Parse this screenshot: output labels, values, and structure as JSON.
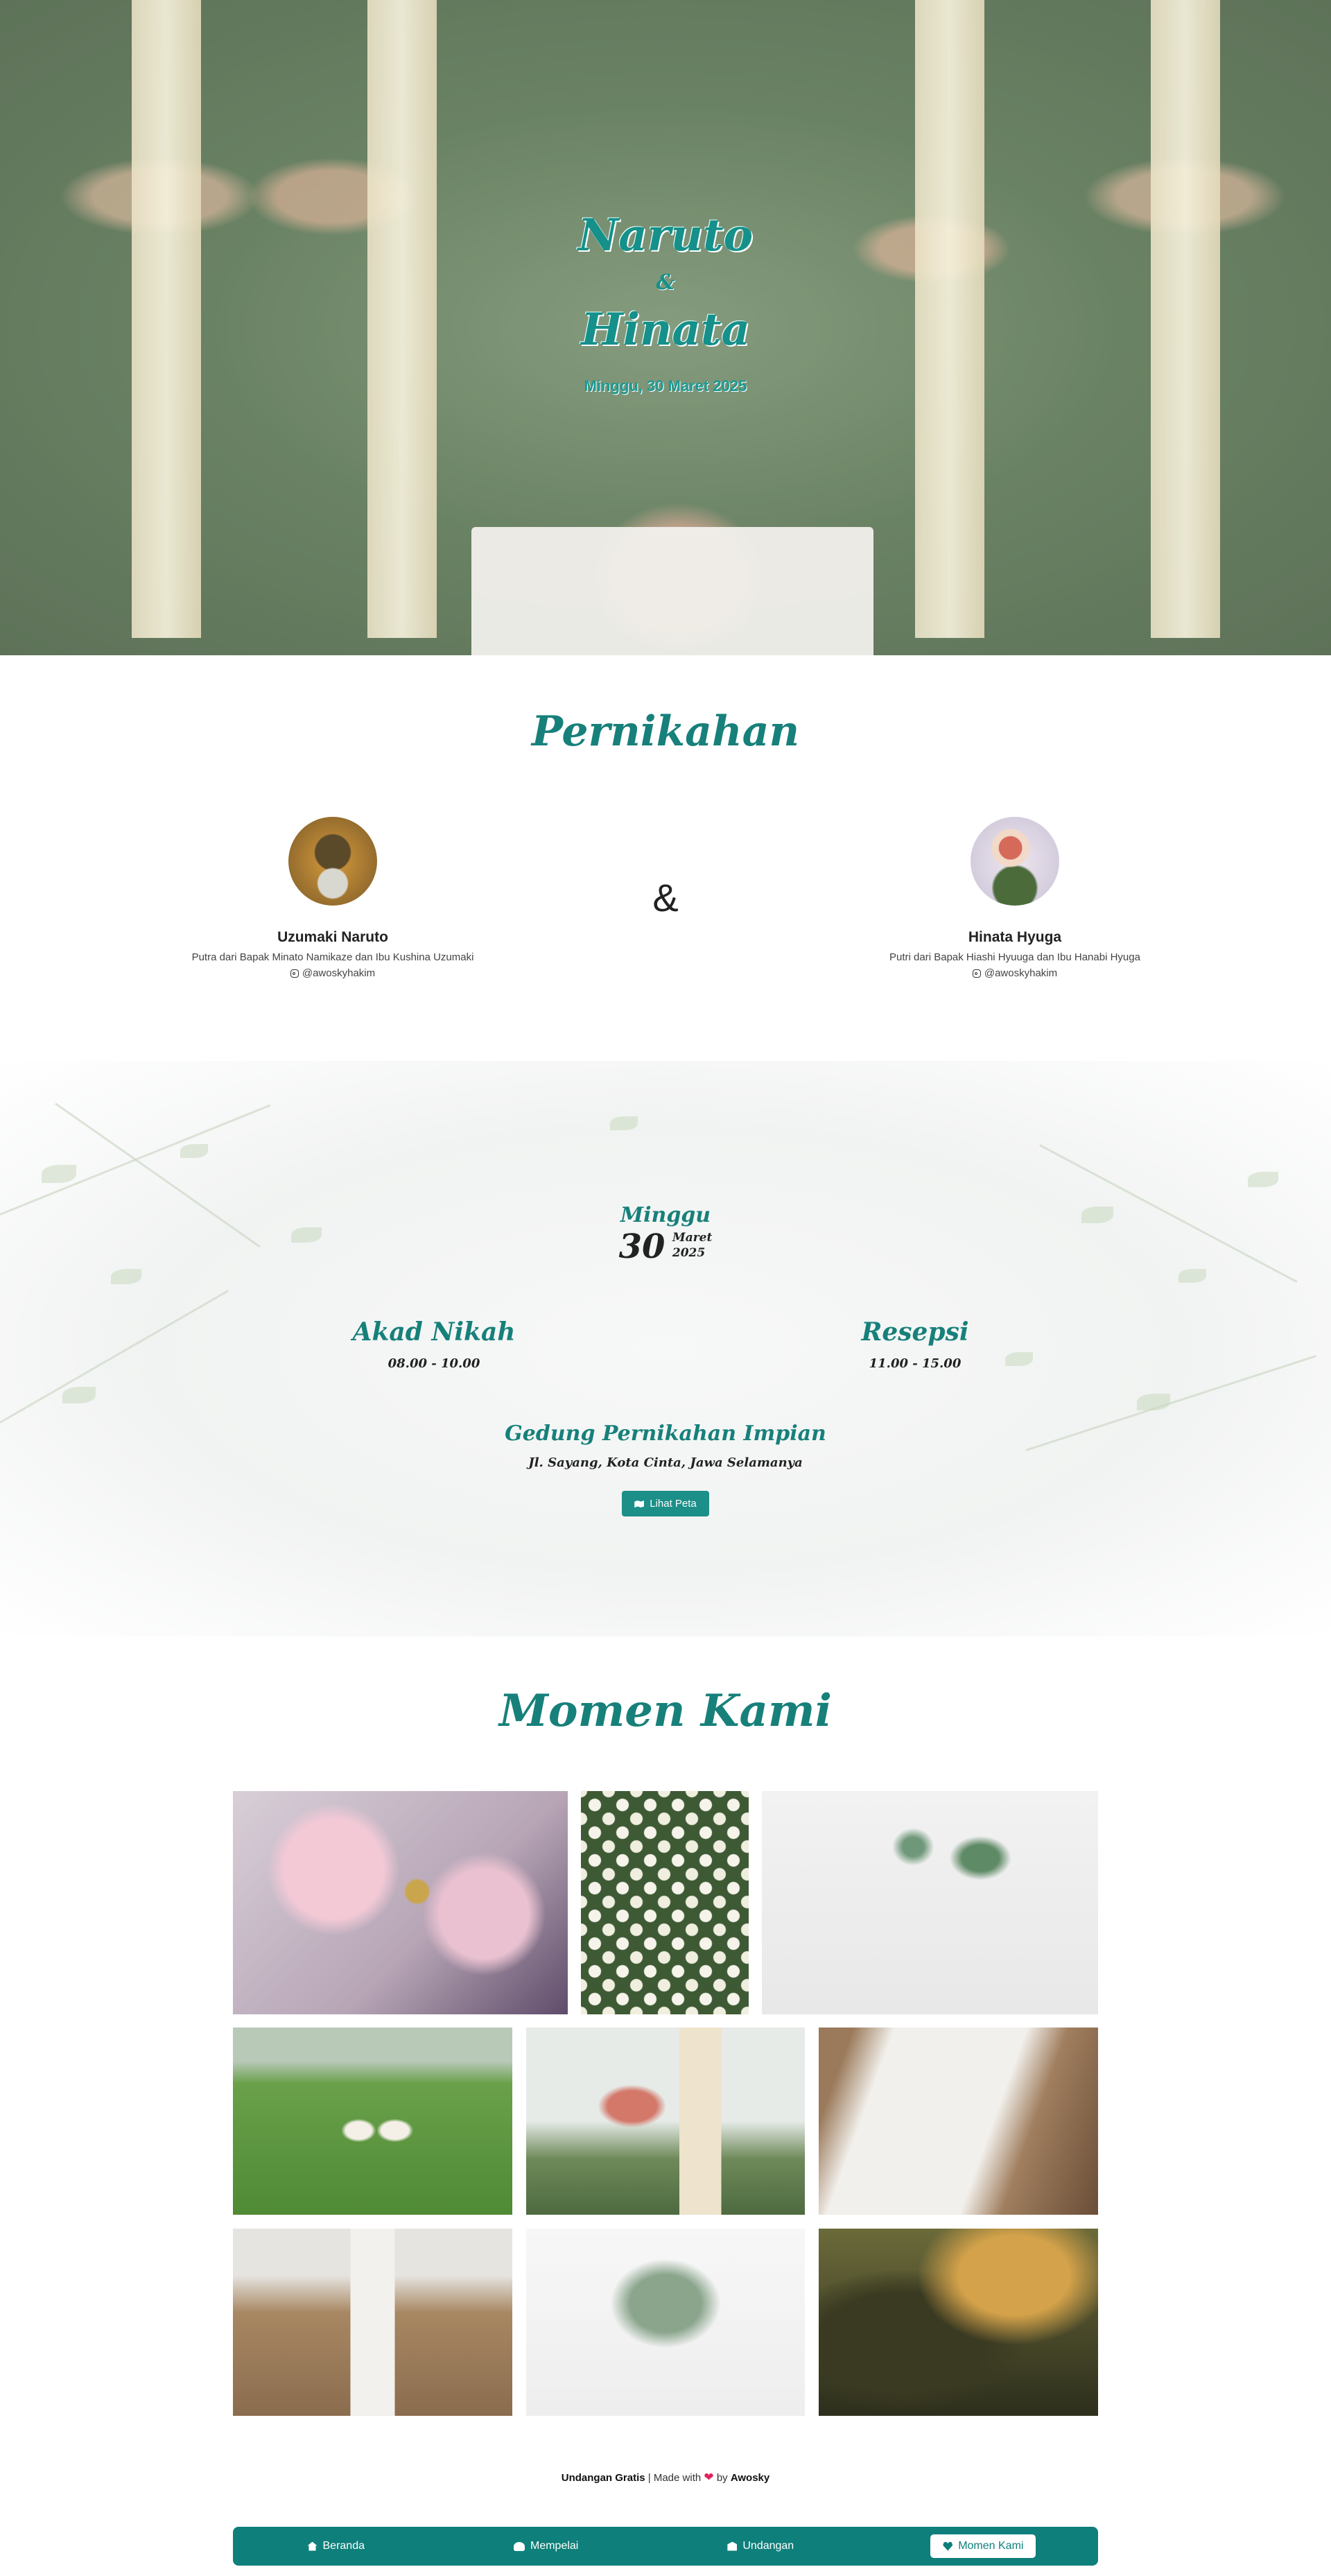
{
  "hero": {
    "groom_name": "Naruto",
    "ampersand": "&",
    "bride_name": "Hinata",
    "date": "Minggu, 30 Maret 2025"
  },
  "wedding": {
    "title": "Pernikahan",
    "and": "&",
    "groom": {
      "name": "Uzumaki Naruto",
      "parents": "Putra dari Bapak Minato Namikaze dan Ibu Kushina Uzumaki",
      "instagram": "@awoskyhakim"
    },
    "bride": {
      "name": "Hinata Hyuga",
      "parents": "Putri dari Bapak Hiashi Hyuuga dan Ibu Hanabi Hyuga",
      "instagram": "@awoskyhakim"
    }
  },
  "invitation": {
    "day": "Minggu",
    "date_day": "30",
    "date_month": "Maret",
    "date_year": "2025",
    "akad": {
      "title": "Akad Nikah",
      "time": "08.00 - 10.00"
    },
    "resepsi": {
      "title": "Resepsi",
      "time": "11.00 - 15.00"
    },
    "venue": "Gedung Pernikahan Impian",
    "address": "Jl. Sayang, Kota Cinta, Jawa Selamanya",
    "map_button": "Lihat Peta"
  },
  "gallery": {
    "title": "Momen Kami"
  },
  "footer": {
    "free_invite": "Undangan Gratis",
    "made_with": "| Made with",
    "by": "by",
    "author": "Awosky"
  },
  "nav": {
    "items": [
      {
        "label": "Beranda",
        "icon": "home-icon"
      },
      {
        "label": "Mempelai",
        "icon": "users-icon"
      },
      {
        "label": "Undangan",
        "icon": "envelope-icon"
      },
      {
        "label": "Momen Kami",
        "icon": "heart-icon"
      }
    ],
    "active": "Momen Kami"
  },
  "colors": {
    "accent": "#17807a",
    "nav_bg": "#0e7f7a",
    "heart": "#e0245e"
  }
}
